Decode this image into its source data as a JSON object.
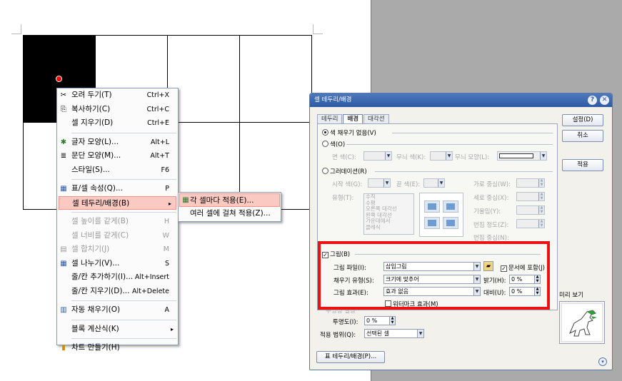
{
  "context_menu": {
    "items": [
      {
        "label": "오려 두기(T)",
        "shortcut": "Ctrl+X",
        "icon": "scissors-icon"
      },
      {
        "label": "복사하기(C)",
        "shortcut": "Ctrl+C",
        "icon": "copy-icon"
      },
      {
        "label": "셀 지우기(D)",
        "shortcut": "Ctrl+E"
      },
      {
        "label": "글자 모양(L)...",
        "shortcut": "Alt+L",
        "icon": "char-shape-icon"
      },
      {
        "label": "문단 모양(M)...",
        "shortcut": "Alt+T",
        "icon": "paragraph-icon"
      },
      {
        "label": "스타일(S)...",
        "shortcut": "F6"
      },
      {
        "label": "표/셀 속성(Q)...",
        "shortcut": "P",
        "icon": "table-props-icon"
      },
      {
        "label": "셀 테두리/배경(B)"
      },
      {
        "label": "셀 높이를 같게(B)",
        "shortcut": "H"
      },
      {
        "label": "셀 너비를 같게(C)",
        "shortcut": "W"
      },
      {
        "label": "셀 합치기(J)",
        "shortcut": "M",
        "icon": "merge-cells-icon"
      },
      {
        "label": "셀 나누기(V)...",
        "shortcut": "S",
        "icon": "split-cells-icon"
      },
      {
        "label": "줄/칸 추가하기(I)...",
        "shortcut": "Alt+Insert"
      },
      {
        "label": "줄/칸 지우기(D)...",
        "shortcut": "Alt+Delete"
      },
      {
        "label": "자동 채우기(O)",
        "shortcut": "A",
        "icon": "autofill-icon"
      },
      {
        "label": "블록 계산식(K)"
      },
      {
        "label": "차트 만들기(H)",
        "icon": "chart-icon"
      }
    ]
  },
  "submenu": {
    "items": [
      {
        "label": "각 셀마다 적용(E)...",
        "icon": "each-cell-icon"
      },
      {
        "label": "여러 셀에 걸쳐 적용(Z)..."
      }
    ]
  },
  "dialog": {
    "title": "셀 테두리/배경",
    "tabs": [
      "테두리",
      "배경",
      "대각선"
    ],
    "no_fill": "색 채우기 없음(V)",
    "color": "색(O)",
    "face_color": "면 색(C):",
    "pattern_color": "무늬 색(K):",
    "pattern_shape": "무늬 모양(L):",
    "gradation": "그러데이션(R)",
    "start_color": "시작 색(G):",
    "end_color": "끝 색(E):",
    "type": "유형(T):",
    "type_list": [
      "수직",
      "수평",
      "오른쪽 대각선",
      "왼쪽 대각선",
      "가운데에서",
      "클레식"
    ],
    "h_center": "가로 중심(W):",
    "v_center": "세로 중심(X):",
    "tilt": "기울임(Y):",
    "blur": "번짐 정도(Z):",
    "blur_center": "번짐 중심(N):",
    "picture": "그림(B)",
    "picture_file": "그림 파일(I):",
    "picture_file_value": "삽입그림",
    "include_doc": "문서에 포함(J)",
    "fill_type": "채우기 유형(S):",
    "fill_type_value": "크기에 맞추어",
    "brightness": "밝기(H):",
    "brightness_value": "0 %",
    "effect": "그림 효과(E):",
    "effect_value": "효과 없음",
    "contrast": "대비(U):",
    "contrast_value": "0 %",
    "watermark": "워터마크 효과(M)",
    "transparency_group": "투명성 설정",
    "transparency": "투명도(I):",
    "transparency_value": "0 %",
    "apply_range": "적용 범위(Q):",
    "apply_range_value": "선택된 셀",
    "border_bg_button": "표 테두리/배경(P)...",
    "btn_ok": "설정(D)",
    "btn_cancel": "취소",
    "btn_apply": "적용",
    "preview": "미리 보기"
  }
}
